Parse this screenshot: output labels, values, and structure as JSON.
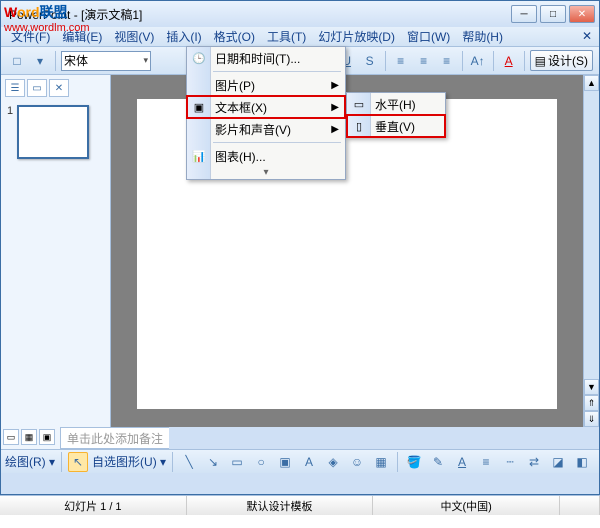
{
  "titlebar": {
    "title": "PowerPoint - [演示文稿1]"
  },
  "watermark": {
    "brand_w": "W",
    "brand_ord": "ord",
    "brand_lm": "联盟",
    "url": "www.wordlm.com"
  },
  "window_controls": {
    "min": "─",
    "max": "□",
    "close": "✕"
  },
  "menubar": {
    "file": "文件(F)",
    "edit": "编辑(E)",
    "view": "视图(V)",
    "insert": "插入(I)",
    "format": "格式(O)",
    "tools": "工具(T)",
    "slideshow": "幻灯片放映(D)",
    "window": "窗口(W)",
    "help": "帮助(H)"
  },
  "formatbar": {
    "font": "宋体",
    "design": "设计(S)"
  },
  "insert_menu": {
    "datetime": "日期和时间(T)...",
    "picture": "图片(P)",
    "textbox": "文本框(X)",
    "movie_sound": "影片和声音(V)",
    "chart": "图表(H)..."
  },
  "textbox_submenu": {
    "horizontal": "水平(H)",
    "vertical": "垂直(V)"
  },
  "outline": {
    "slide_num": "1"
  },
  "notes": {
    "placeholder": "单击此处添加备注"
  },
  "drawbar": {
    "draw": "绘图(R)",
    "autoshapes": "自选图形(U)"
  },
  "status": {
    "slide": "幻灯片 1 / 1",
    "template": "默认设计模板",
    "lang": "中文(中国)"
  }
}
